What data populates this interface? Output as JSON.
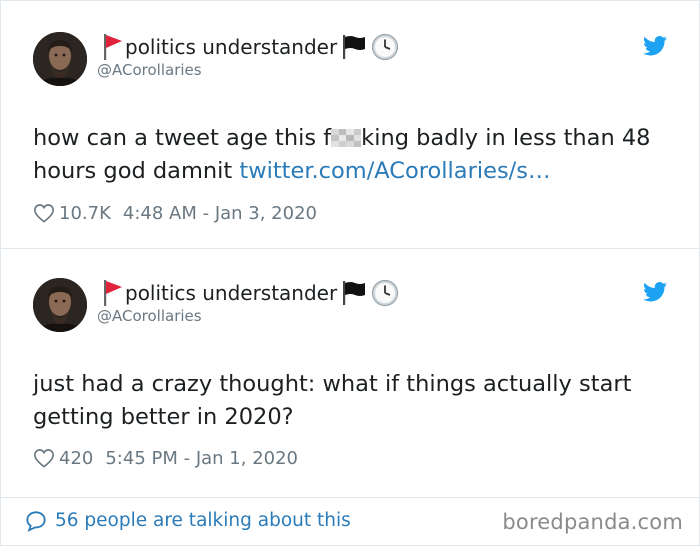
{
  "tweets": [
    {
      "display_name": "politics understander",
      "handle": "@ACorollaries",
      "text_before": "how can a tweet age this f",
      "text_after": "king badly in less than 48 hours god damnit ",
      "link": "twitter.com/ACorollaries/s…",
      "likes": "10.7K",
      "timestamp": "4:48 AM - Jan 3, 2020"
    },
    {
      "display_name": "politics understander",
      "handle": "@ACorollaries",
      "text": "just had a crazy thought: what if things actually start getting better in 2020?",
      "likes": "420",
      "timestamp": "5:45 PM - Jan 1, 2020"
    }
  ],
  "footer": {
    "talking_text": "56 people are talking about this",
    "watermark": "boredpanda.com"
  },
  "colors": {
    "link": "#2b7bb9",
    "muted": "#697882",
    "twitter_blue": "#1da1f2",
    "flag_red": "#e0223a"
  },
  "icons": [
    "red-flag-icon",
    "black-flag-icon",
    "clock-icon",
    "twitter-bird-icon",
    "heart-icon",
    "speech-bubble-icon"
  ]
}
